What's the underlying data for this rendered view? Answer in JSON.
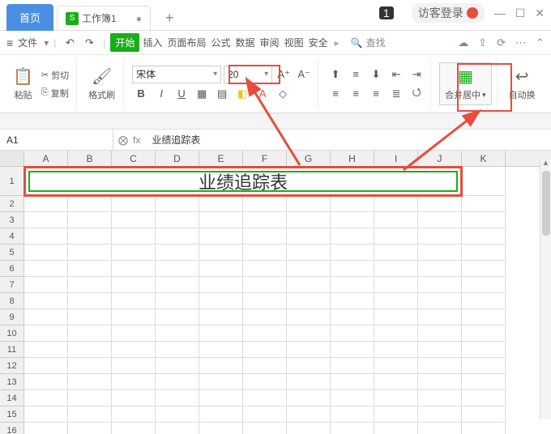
{
  "window": {
    "badge": "1",
    "guest_login": "访客登录"
  },
  "tabs": {
    "home": "首页",
    "doc_icon": "S",
    "doc_name": "工作簿1",
    "doc_dirty": "●",
    "new": "+"
  },
  "menu": {
    "file": "文件",
    "items": [
      "开始",
      "插入",
      "页面布局",
      "公式",
      "数据",
      "审阅",
      "视图",
      "安全"
    ],
    "search": "查找"
  },
  "toolbar": {
    "paste": "粘贴",
    "cut": "剪切",
    "copy": "复制",
    "format_painter": "格式刷",
    "font_name": "宋体",
    "font_size": "20",
    "merge_center": "合并居中",
    "autowrap": "自动换"
  },
  "namebox": {
    "ref": "A1",
    "fx": "fx",
    "formula": "业绩追踪表"
  },
  "grid": {
    "cols": [
      "A",
      "B",
      "C",
      "D",
      "E",
      "F",
      "G",
      "H",
      "I",
      "J",
      "K"
    ],
    "rows": [
      "1",
      "2",
      "3",
      "4",
      "5",
      "6",
      "7",
      "8",
      "9",
      "10",
      "11",
      "12",
      "13",
      "14",
      "15",
      "16"
    ],
    "a1_value": "业绩追踪表"
  }
}
